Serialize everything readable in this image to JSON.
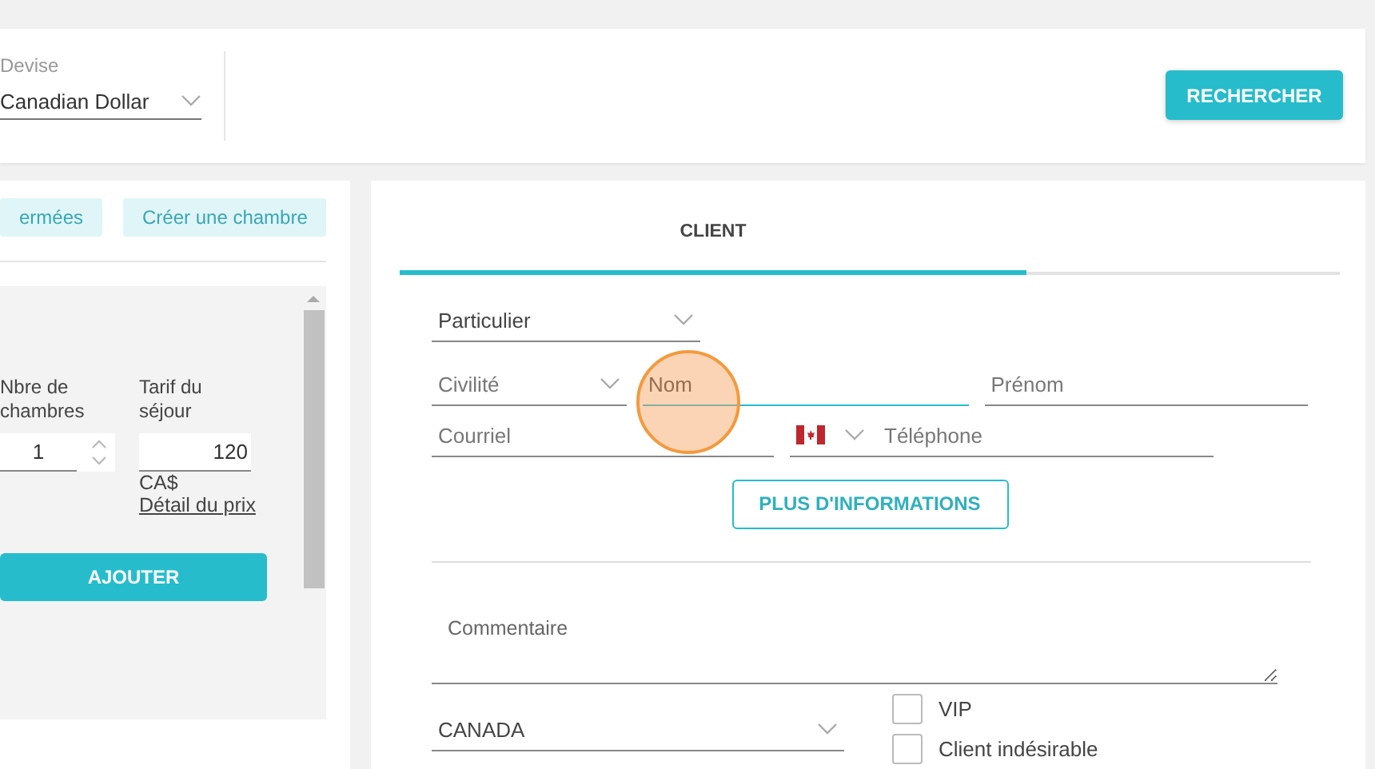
{
  "currency": {
    "label": "Devise",
    "value": "Canadian Dollar"
  },
  "search_button": "RECHERCHER",
  "room_actions": [
    "ermées",
    "Créer une chambre"
  ],
  "room_form": {
    "rooms_label": "Nbre de chambres",
    "rooms_value": "1",
    "rate_label": "Tarif du séjour",
    "rate_value": "120",
    "currency_unit": "CA$",
    "price_detail_link": "Détail du prix",
    "add_button": "AJOUTER"
  },
  "tabs": [
    {
      "label": "CLIENT",
      "selected": true
    }
  ],
  "client_form": {
    "type": "Particulier",
    "civility_placeholder": "Civilité",
    "last_name_placeholder": "Nom",
    "first_name_placeholder": "Prénom",
    "email_placeholder": "Courriel",
    "phone_placeholder": "Téléphone",
    "more_info_button": "PLUS D'INFORMATIONS",
    "comment_placeholder": "Commentaire",
    "country": "CANADA",
    "checkboxes": [
      {
        "label": "VIP",
        "checked": false
      },
      {
        "label": "Client indésirable",
        "checked": false
      }
    ]
  },
  "click_highlight": {
    "on": true
  }
}
